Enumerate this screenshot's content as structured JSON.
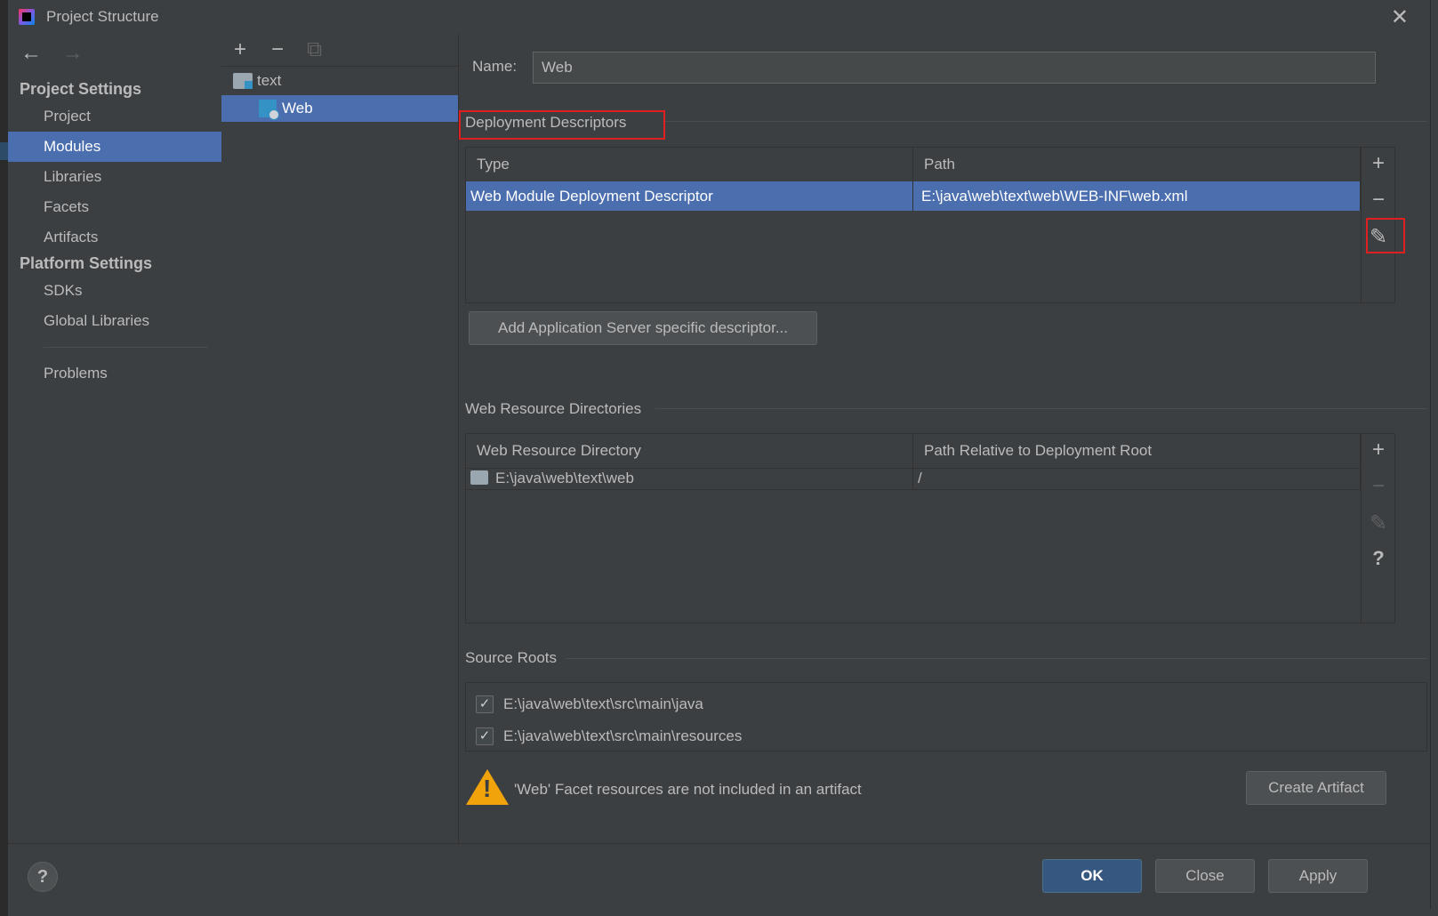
{
  "window": {
    "title": "Project Structure"
  },
  "nav": {
    "back": "←",
    "forward": "→",
    "project_settings": "Project Settings",
    "platform_settings": "Platform Settings",
    "items": [
      "Project",
      "Modules",
      "Libraries",
      "Facets",
      "Artifacts",
      "SDKs",
      "Global Libraries",
      "Problems"
    ],
    "selected": "Modules"
  },
  "tree": {
    "toolbar": {
      "add": "+",
      "remove": "−",
      "copy": "⧉"
    },
    "nodes": [
      {
        "label": "text"
      },
      {
        "label": "Web"
      }
    ]
  },
  "facet": {
    "name_label": "Name:",
    "name_value": "Web",
    "deployment": {
      "title": "Deployment Descriptors",
      "columns": [
        "Type",
        "Path"
      ],
      "rows": [
        {
          "type": "Web Module Deployment Descriptor",
          "path": "E:\\java\\web\\text\\web\\WEB-INF\\web.xml"
        }
      ],
      "add_server_button": "Add Application Server specific descriptor..."
    },
    "web_resources": {
      "title": "Web Resource Directories",
      "columns": [
        "Web Resource Directory",
        "Path Relative to Deployment Root"
      ],
      "rows": [
        {
          "dir": "E:\\java\\web\\text\\web",
          "rel": "/"
        }
      ]
    },
    "source_roots": {
      "title": "Source Roots",
      "items": [
        "E:\\java\\web\\text\\src\\main\\java",
        "E:\\java\\web\\text\\src\\main\\resources"
      ]
    },
    "warning": "'Web' Facet resources are not included in an artifact",
    "create_artifact": "Create Artifact"
  },
  "side_tools": {
    "add": "+",
    "remove": "−",
    "edit": "✎",
    "help": "?"
  },
  "footer": {
    "help": "?",
    "ok": "OK",
    "close": "Close",
    "apply": "Apply"
  },
  "colors": {
    "background": "#3c3f41",
    "selection": "#4b6eaf",
    "highlight": "#e02020",
    "warning": "#f0a30a",
    "primary_button": "#365880"
  }
}
